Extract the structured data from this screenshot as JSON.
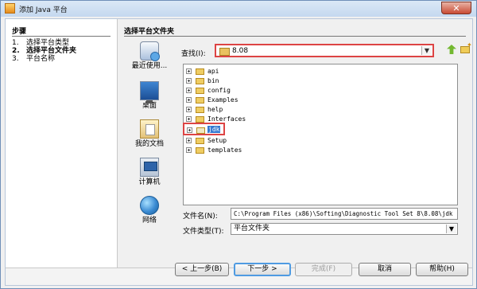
{
  "window": {
    "title": "添加 Java 平台",
    "close_symbol": "✕"
  },
  "steps": {
    "heading": "步骤",
    "items": [
      {
        "num": "1.",
        "label": "选择平台类型"
      },
      {
        "num": "2.",
        "label": "选择平台文件夹"
      },
      {
        "num": "3.",
        "label": "平台名称"
      }
    ]
  },
  "content": {
    "heading": "选择平台文件夹"
  },
  "places": [
    {
      "label": "最近使用...",
      "icon": "recent-icon"
    },
    {
      "label": "桌面",
      "icon": "desktop-icon"
    },
    {
      "label": "我的文档",
      "icon": "documents-icon"
    },
    {
      "label": "计算机",
      "icon": "computer-icon"
    },
    {
      "label": "网络",
      "icon": "network-icon"
    }
  ],
  "look_in": {
    "label": "查找(I):",
    "value": "8.08"
  },
  "files": [
    "api",
    "bin",
    "config",
    "Examples",
    "help",
    "Interfaces",
    "jdk",
    "Setup",
    "templates"
  ],
  "selected_file": "jdk",
  "file_name": {
    "label": "文件名(N):",
    "value": "C:\\Program Files (x86)\\Softing\\Diagnostic Tool Set 8\\8.08\\jdk"
  },
  "file_type": {
    "label": "文件类型(T):",
    "value": "平台文件夹"
  },
  "buttons": {
    "back": "< 上一步(B)",
    "next": "下一步 >",
    "finish": "完成(F)",
    "cancel": "取消",
    "help": "帮助(H)"
  }
}
